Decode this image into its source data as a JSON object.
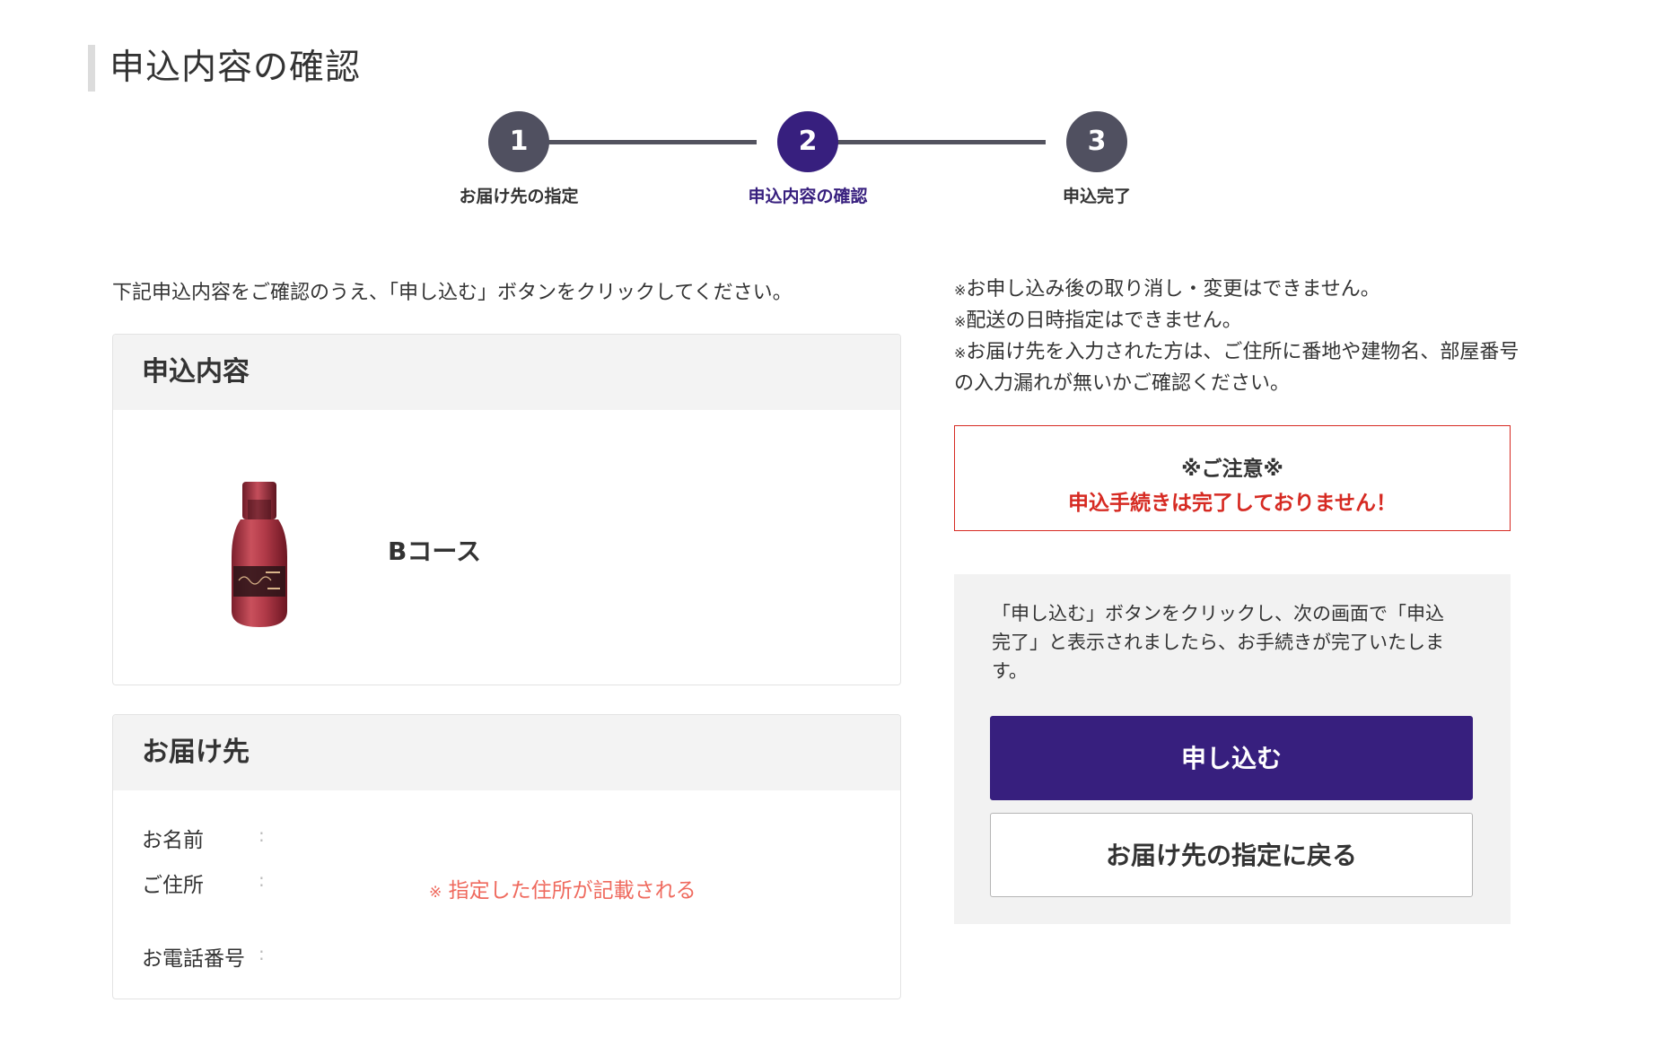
{
  "page": {
    "title": "申込内容の確認"
  },
  "steps": [
    {
      "number": "1",
      "label": "お届け先の指定",
      "active": false
    },
    {
      "number": "2",
      "label": "申込内容の確認",
      "active": true
    },
    {
      "number": "3",
      "label": "申込完了",
      "active": false
    }
  ],
  "intro": "下記申込内容をご確認のうえ、「申し込む」ボタンをクリックしてください。",
  "order_panel": {
    "title": "申込内容",
    "product_name": "Bコース"
  },
  "delivery_panel": {
    "title": "お届け先",
    "fields": [
      {
        "label": "お名前",
        "value": ""
      },
      {
        "label": "ご住所",
        "value": ""
      },
      {
        "label": "お電話番号",
        "value": ""
      }
    ],
    "address_note_mark": "※",
    "address_note": "指定した住所が記載される"
  },
  "notes": [
    {
      "mark": "※",
      "text": "お申し込み後の取り消し・変更はできません。"
    },
    {
      "mark": "※",
      "text": "配送の日時指定はできません。"
    },
    {
      "mark": "※",
      "text": "お届け先を入力された方は、ご住所に番地や建物名、部屋番号の入力漏れが無いかご確認ください。"
    }
  ],
  "caution": {
    "title": "※ご注意※",
    "text": "申込手続きは完了しておりません！"
  },
  "action": {
    "text": "「申し込む」ボタンをクリックし、次の画面で「申込完了」と表示されましたら、お手続きが完了いたします。",
    "submit_label": "申し込む",
    "back_label": "お届け先の指定に戻る"
  },
  "colors": {
    "brand": "#371f7e",
    "step_inactive": "#505060",
    "caution_red": "#d62a22",
    "note_red": "#ef6a5e"
  }
}
